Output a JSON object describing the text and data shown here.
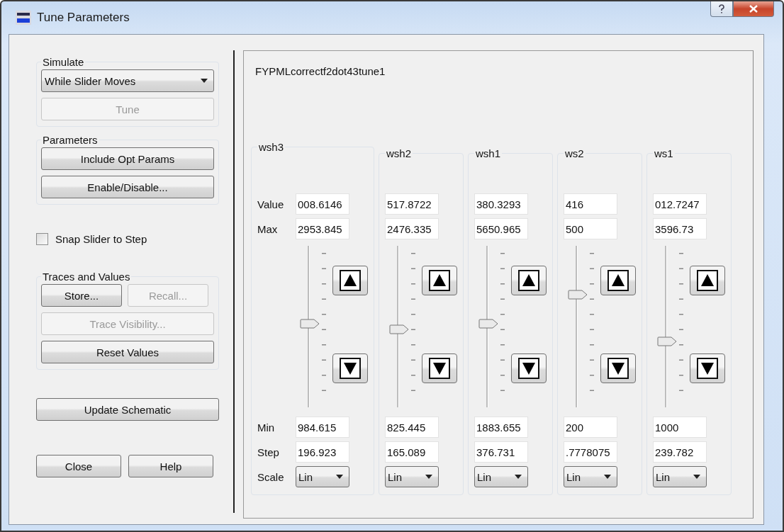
{
  "window": {
    "title": "Tune Parameters"
  },
  "simulate": {
    "label": "Simulate",
    "mode": "While Slider Moves",
    "tune_button": {
      "label": "Tune",
      "disabled": true
    }
  },
  "parameters": {
    "label": "Parameters",
    "buttons": [
      {
        "label": "Include Opt Params",
        "disabled": false
      },
      {
        "label": "Enable/Disable...",
        "disabled": false
      }
    ]
  },
  "snap_slider": {
    "label": "Snap Slider to Step",
    "checked": false
  },
  "traces": {
    "label": "Traces and Values",
    "buttons": [
      {
        "label": "Store...",
        "disabled": false
      },
      {
        "label": "Recall...",
        "disabled": true
      },
      {
        "label": "Trace Visibility...",
        "disabled": true
      },
      {
        "label": "Reset Values",
        "disabled": false
      }
    ]
  },
  "update_button": "Update Schematic",
  "footer_buttons": [
    "Close",
    "Help"
  ],
  "tune_panel": {
    "title": "FYPMLcorrectf2dot43tune1",
    "row_labels": {
      "value": "Value",
      "max": "Max",
      "min": "Min",
      "step": "Step",
      "scale": "Scale"
    },
    "params": [
      {
        "name": "wsh3",
        "value": "008.6146",
        "max": "2953.845",
        "level": 0.52,
        "min": "984.615",
        "step": "196.923",
        "scale": "Lin"
      },
      {
        "name": "wsh2",
        "value": "517.8722",
        "max": "2476.335",
        "level": 0.48,
        "min": "825.445",
        "step": "165.089",
        "scale": "Lin"
      },
      {
        "name": "wsh1",
        "value": "380.3293",
        "max": "5650.965",
        "level": 0.52,
        "min": "1883.655",
        "step": "376.731",
        "scale": "Lin"
      },
      {
        "name": "ws2",
        "value": "416",
        "max": "500",
        "level": 0.71,
        "min": "200",
        "step": ".7778075",
        "scale": "Lin"
      },
      {
        "name": "ws1",
        "value": "012.7247",
        "max": "3596.73",
        "level": 0.4,
        "min": "1000",
        "step": "239.782",
        "scale": "Lin"
      }
    ]
  }
}
